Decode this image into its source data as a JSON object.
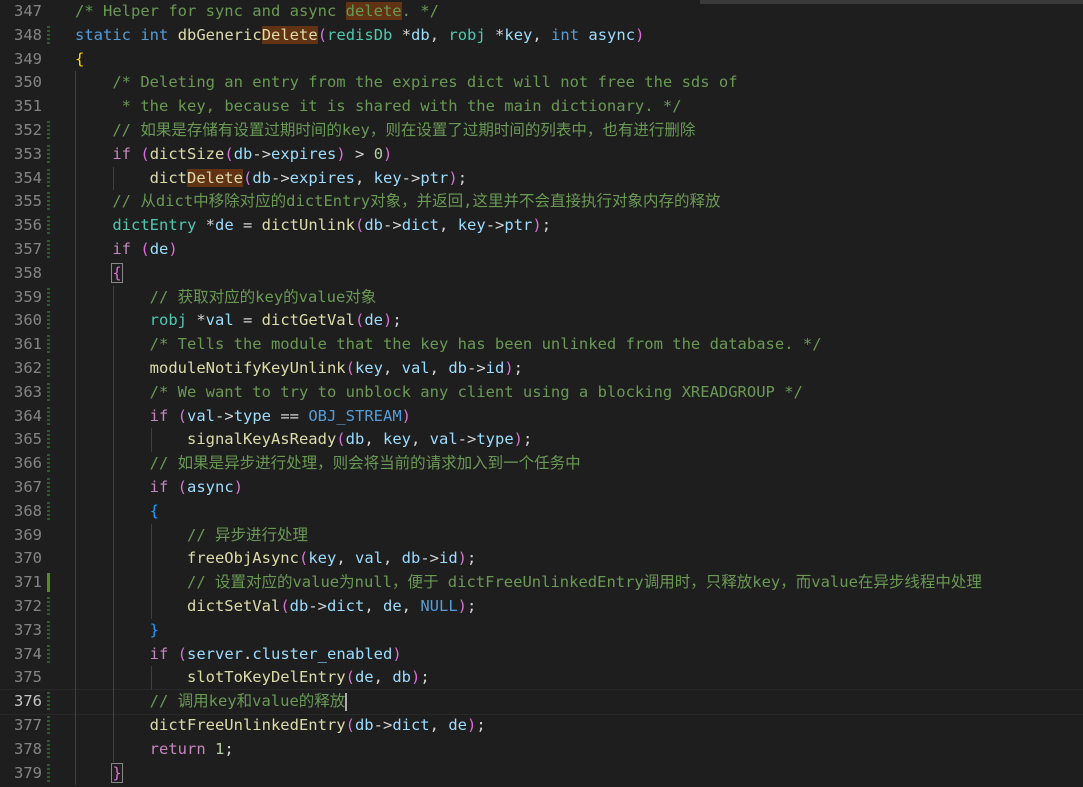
{
  "editor": {
    "lines": [
      {
        "n": "347",
        "t": "/* Helper for sync and async delete. */"
      },
      {
        "n": "348",
        "t": "static int dbGenericDelete(redisDb *db, robj *key, int async)"
      },
      {
        "n": "349",
        "t": "{"
      },
      {
        "n": "350",
        "t": "    /* Deleting an entry from the expires dict will not free the sds of"
      },
      {
        "n": "351",
        "t": "     * the key, because it is shared with the main dictionary. */"
      },
      {
        "n": "352",
        "t": "    // 如果是存储有设置过期时间的key，则在设置了过期时间的列表中，也有进行删除"
      },
      {
        "n": "353",
        "t": "    if (dictSize(db->expires) > 0)"
      },
      {
        "n": "354",
        "t": "        dictDelete(db->expires, key->ptr);"
      },
      {
        "n": "355",
        "t": "    // 从dict中移除对应的dictEntry对象，并返回,这里并不会直接执行对象内存的释放"
      },
      {
        "n": "356",
        "t": "    dictEntry *de = dictUnlink(db->dict, key->ptr);"
      },
      {
        "n": "357",
        "t": "    if (de)"
      },
      {
        "n": "358",
        "t": "    {"
      },
      {
        "n": "359",
        "t": "        // 获取对应的key的value对象"
      },
      {
        "n": "360",
        "t": "        robj *val = dictGetVal(de);"
      },
      {
        "n": "361",
        "t": "        /* Tells the module that the key has been unlinked from the database. */"
      },
      {
        "n": "362",
        "t": "        moduleNotifyKeyUnlink(key, val, db->id);"
      },
      {
        "n": "363",
        "t": "        /* We want to try to unblock any client using a blocking XREADGROUP */"
      },
      {
        "n": "364",
        "t": "        if (val->type == OBJ_STREAM)"
      },
      {
        "n": "365",
        "t": "            signalKeyAsReady(db, key, val->type);"
      },
      {
        "n": "366",
        "t": "        // 如果是异步进行处理，则会将当前的请求加入到一个任务中"
      },
      {
        "n": "367",
        "t": "        if (async)"
      },
      {
        "n": "368",
        "t": "        {"
      },
      {
        "n": "369",
        "t": "            // 异步进行处理"
      },
      {
        "n": "370",
        "t": "            freeObjAsync(key, val, db->id);"
      },
      {
        "n": "371",
        "t": "            // 设置对应的value为null，便于 dictFreeUnlinkedEntry调用时，只释放key，而value在异步线程中处理"
      },
      {
        "n": "372",
        "t": "            dictSetVal(db->dict, de, NULL);"
      },
      {
        "n": "373",
        "t": "        }"
      },
      {
        "n": "374",
        "t": "        if (server.cluster_enabled)"
      },
      {
        "n": "375",
        "t": "            slotToKeyDelEntry(de, db);"
      },
      {
        "n": "376",
        "t": "        // 调用key和value的释放"
      },
      {
        "n": "377",
        "t": "        dictFreeUnlinkedEntry(db->dict, de);"
      },
      {
        "n": "378",
        "t": "        return 1;"
      },
      {
        "n": "379",
        "t": "    }"
      }
    ]
  },
  "colors": {
    "background": "#1e1e1e",
    "line_number": "#858585",
    "comment": "#6a9955",
    "keyword": "#569cd6",
    "control": "#c586c0",
    "function": "#dcdcaa",
    "type": "#4ec9b0",
    "variable": "#9cdcfe",
    "number": "#b5cea8",
    "search_highlight": "#613214"
  }
}
